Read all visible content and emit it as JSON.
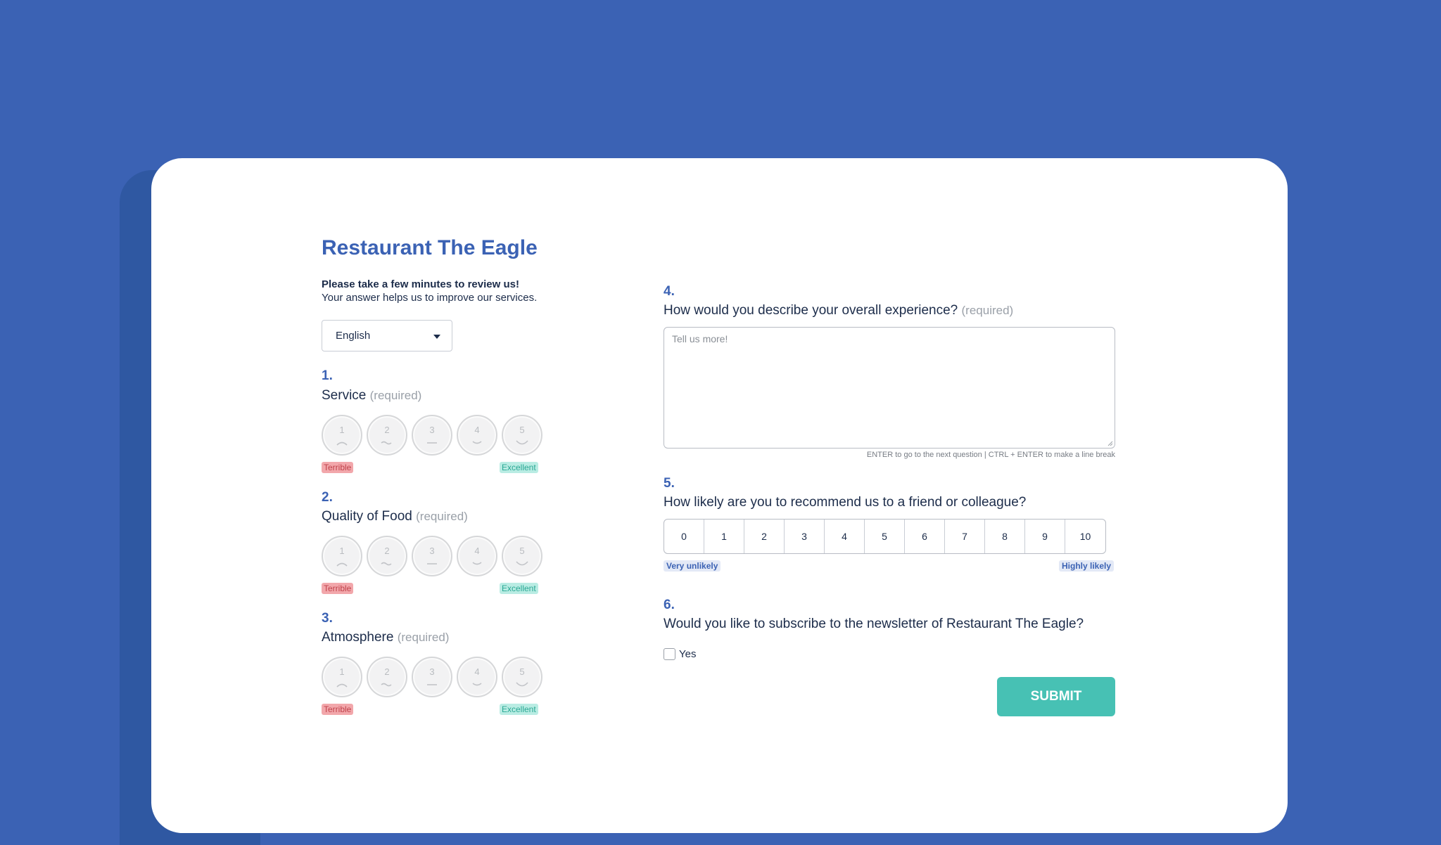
{
  "form": {
    "title": "Restaurant The Eagle",
    "intro_bold": "Please take a few minutes to review us!",
    "intro_text": "Your answer helps us to improve our services.",
    "language": "English"
  },
  "rating_questions": [
    {
      "number": "1.",
      "label": "Service",
      "required": "(required)",
      "low": "Terrible",
      "high": "Excellent",
      "scale": [
        "1",
        "2",
        "3",
        "4",
        "5"
      ]
    },
    {
      "number": "2.",
      "label": "Quality of Food",
      "required": "(required)",
      "low": "Terrible",
      "high": "Excellent",
      "scale": [
        "1",
        "2",
        "3",
        "4",
        "5"
      ]
    },
    {
      "number": "3.",
      "label": "Atmosphere",
      "required": "(required)",
      "low": "Terrible",
      "high": "Excellent",
      "scale": [
        "1",
        "2",
        "3",
        "4",
        "5"
      ]
    }
  ],
  "q4": {
    "number": "4.",
    "label": "How would you describe your overall experience?",
    "required": "(required)",
    "placeholder": "Tell us more!",
    "hint": "ENTER to go to the next question | CTRL + ENTER to make a line break"
  },
  "q5": {
    "number": "5.",
    "label": "How likely are you to recommend us to a friend or colleague?",
    "scale": [
      "0",
      "1",
      "2",
      "3",
      "4",
      "5",
      "6",
      "7",
      "8",
      "9",
      "10"
    ],
    "low": "Very unlikely",
    "high": "Highly likely"
  },
  "q6": {
    "number": "6.",
    "label": "Would you like to subscribe to the newsletter of Restaurant The Eagle?",
    "option": "Yes"
  },
  "submit_label": "SUBMIT",
  "colors": {
    "background": "#3b62b4",
    "accent_blue": "#3b62b4",
    "submit": "#47c1b4",
    "terrible": "#f2a7ab",
    "excellent": "#b9ece3"
  }
}
